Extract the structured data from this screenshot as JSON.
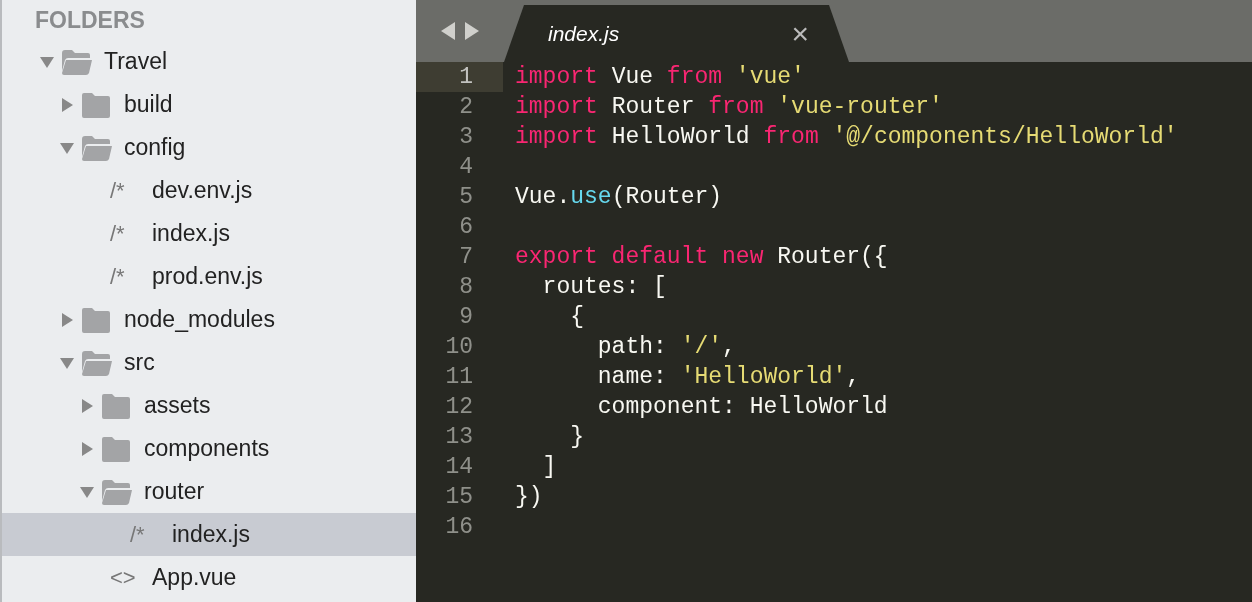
{
  "sidebar": {
    "heading": "FOLDERS",
    "tree": [
      {
        "kind": "folder",
        "label": "Travel",
        "expanded": true,
        "selected": false,
        "children": [
          {
            "kind": "folder",
            "label": "build",
            "expanded": false,
            "selected": false
          },
          {
            "kind": "folder",
            "label": "config",
            "expanded": true,
            "selected": false,
            "children": [
              {
                "kind": "file",
                "icon": "/*",
                "label": "dev.env.js",
                "selected": false
              },
              {
                "kind": "file",
                "icon": "/*",
                "label": "index.js",
                "selected": false
              },
              {
                "kind": "file",
                "icon": "/*",
                "label": "prod.env.js",
                "selected": false
              }
            ]
          },
          {
            "kind": "folder",
            "label": "node_modules",
            "expanded": false,
            "selected": false
          },
          {
            "kind": "folder",
            "label": "src",
            "expanded": true,
            "selected": false,
            "children": [
              {
                "kind": "folder",
                "label": "assets",
                "expanded": false,
                "selected": false
              },
              {
                "kind": "folder",
                "label": "components",
                "expanded": false,
                "selected": false
              },
              {
                "kind": "folder",
                "label": "router",
                "expanded": true,
                "selected": false,
                "children": [
                  {
                    "kind": "file",
                    "icon": "/*",
                    "label": "index.js",
                    "selected": true
                  }
                ]
              },
              {
                "kind": "file",
                "icon": "<>",
                "label": "App.vue",
                "selected": false
              }
            ]
          }
        ]
      }
    ]
  },
  "editor": {
    "tabs": [
      {
        "label": "index.js",
        "close": "×",
        "selected": true
      }
    ],
    "lines": [
      {
        "number": "1",
        "current": true,
        "tokens": [
          {
            "kind": "keyword",
            "text": "import"
          },
          {
            "kind": "plain",
            "text": " Vue "
          },
          {
            "kind": "keyword",
            "text": "from"
          },
          {
            "kind": "string",
            "text": " 'vue'"
          }
        ]
      },
      {
        "number": "2",
        "current": false,
        "tokens": [
          {
            "kind": "keyword",
            "text": "import"
          },
          {
            "kind": "plain",
            "text": " Router "
          },
          {
            "kind": "keyword",
            "text": "from"
          },
          {
            "kind": "string",
            "text": " 'vue-router'"
          }
        ]
      },
      {
        "number": "3",
        "current": false,
        "tokens": [
          {
            "kind": "keyword",
            "text": "import"
          },
          {
            "kind": "plain",
            "text": " HelloWorld "
          },
          {
            "kind": "keyword",
            "text": "from"
          },
          {
            "kind": "string",
            "text": " '@/components/HelloWorld'"
          }
        ]
      },
      {
        "number": "4",
        "current": false
      },
      {
        "number": "5",
        "current": false,
        "tokens": [
          {
            "kind": "plain",
            "text": "Vue."
          },
          {
            "kind": "function",
            "text": "use"
          },
          {
            "kind": "plain",
            "text": "(Router)"
          }
        ]
      },
      {
        "number": "6",
        "current": false
      },
      {
        "number": "7",
        "current": false,
        "tokens": [
          {
            "kind": "keyword",
            "text": "export default new"
          },
          {
            "kind": "plain",
            "text": " Router({"
          }
        ]
      },
      {
        "number": "8",
        "current": false,
        "tokens": [
          {
            "kind": "plain",
            "text": "  routes: ["
          }
        ]
      },
      {
        "number": "9",
        "current": false,
        "tokens": [
          {
            "kind": "plain",
            "text": "    {"
          }
        ]
      },
      {
        "number": "10",
        "current": false,
        "tokens": [
          {
            "kind": "plain",
            "text": "      path: "
          },
          {
            "kind": "string",
            "text": "'/'"
          },
          {
            "kind": "plain",
            "text": ","
          }
        ]
      },
      {
        "number": "11",
        "current": false,
        "tokens": [
          {
            "kind": "plain",
            "text": "      name: "
          },
          {
            "kind": "string",
            "text": "'HelloWorld'"
          },
          {
            "kind": "plain",
            "text": ","
          }
        ]
      },
      {
        "number": "12",
        "current": false,
        "tokens": [
          {
            "kind": "plain",
            "text": "      component: HelloWorld"
          }
        ]
      },
      {
        "number": "13",
        "current": false,
        "tokens": [
          {
            "kind": "plain",
            "text": "    }"
          }
        ]
      },
      {
        "number": "14",
        "current": false,
        "tokens": [
          {
            "kind": "plain",
            "text": "  ]"
          }
        ]
      },
      {
        "number": "15",
        "current": false,
        "tokens": [
          {
            "kind": "plain",
            "text": "})"
          }
        ]
      },
      {
        "number": "16",
        "current": false
      }
    ]
  }
}
